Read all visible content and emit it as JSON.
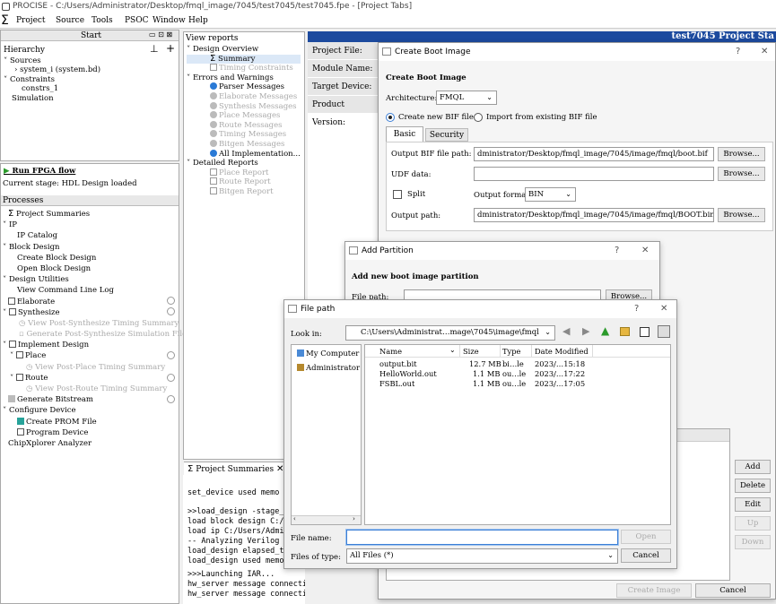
{
  "window": {
    "title": "PROCISE - C:/Users/Administrator/Desktop/fmql_image/7045/test7045/test7045.fpe - [Project Tabs]"
  },
  "menu": [
    "Project",
    "Source",
    "Tools",
    "PSOC",
    "Window",
    "Help"
  ],
  "hierarchy": {
    "start_label": "Start",
    "title": "Hierarchy",
    "items": [
      "Sources",
      "system_i (system.bd)",
      "Constraints",
      "constrs_1",
      "Simulation"
    ]
  },
  "flow": {
    "run_label": "Run FPGA flow",
    "stage": "Current stage: HDL Design loaded",
    "processes_title": "Processes",
    "items": [
      "Project Summaries",
      "IP",
      "IP Catalog",
      "Block Design",
      "Create Block Design",
      "Open Block Design",
      "Design Utilities",
      "View Command Line Log",
      "Elaborate",
      "Synthesize",
      "View Post-Synthesize Timing Summary",
      "Generate Post-Synthesize Simulation File",
      "Implement Design",
      "Place",
      "View Post-Place Timing Summary",
      "Route",
      "View Post-Route Timing Summary",
      "Generate Bitstream",
      "Configure Device",
      "Create PROM File",
      "Program Device",
      "ChipXplorer Analyzer"
    ]
  },
  "reports": {
    "title": "View reports",
    "items": [
      "Design Overview",
      "Summary",
      "Timing Constraints",
      "Errors and Warnings",
      "Parser Messages",
      "Elaborate Messages",
      "Synthesis Messages",
      "Place Messages",
      "Route Messages",
      "Timing Messages",
      "Bitgen Messages",
      "All Implementation...",
      "Detailed Reports",
      "Place Report",
      "Route Report",
      "Bitgen Report"
    ],
    "tab_label": "Project Summaries"
  },
  "project_tab": {
    "header": "test7045 Project Sta",
    "rows": [
      "Project File:",
      "Module Name:",
      "Target Device:",
      "Product Version:"
    ]
  },
  "console": {
    "lines": [
      "set_device used memo",
      ">>load_design -stage_el",
      "  load block design C:/",
      "  load ip C:/Users/Admi",
      "  -- Analyzing Verilog",
      "  load_design elapsed_t",
      "  load_design used memo",
      ">>>Launching IAR...",
      "  hw_server message connection interrupt, err",
      "  hw_server message connection interrupt, err"
    ]
  },
  "boot_dialog": {
    "title": "Create Boot Image",
    "heading": "Create Boot Image",
    "architecture_label": "Architecture:",
    "architecture_value": "FMQL",
    "radio_new": "Create new BIF file",
    "radio_import": "Import from existing BIF file",
    "tabs": [
      "Basic",
      "Security"
    ],
    "output_bif_label": "Output BIF file path:",
    "output_bif_value": "dministrator/Desktop/fmql_image/7045/image/fmql/boot.bif",
    "udf_label": "UDF data:",
    "udf_value": "",
    "split_label": "Split",
    "output_format_label": "Output format",
    "output_format_value": "BIN",
    "output_path_label": "Output path:",
    "output_path_value": "dministrator/Desktop/fmql_image/7045/image/fmql/BOOT.bin",
    "browse": "Browse...",
    "side_buttons": [
      "Add",
      "Delete",
      "Edit",
      "Up",
      "Down"
    ],
    "create_button": "Create Image",
    "cancel_button": "Cancel"
  },
  "partition_dialog": {
    "title": "Add Partition",
    "heading": "Add new boot image partition",
    "file_path_label": "File path:",
    "browse": "Browse..."
  },
  "file_dialog": {
    "title": "File path",
    "look_in_label": "Look in:",
    "look_in_value": "C:\\Users\\Administrat…mage\\7045\\image\\fmql",
    "places": [
      "My Computer",
      "Administrator"
    ],
    "columns": [
      "Name",
      "Size",
      "Type",
      "Date Modified"
    ],
    "files": [
      {
        "name": "output.bit",
        "size": "12.7 MB",
        "type": "bi…le",
        "date": "2023/…15:18"
      },
      {
        "name": "HelloWorld.out",
        "size": "1.1 MB",
        "type": "ou…le",
        "date": "2023/…17:22"
      },
      {
        "name": "FSBL.out",
        "size": "1.1 MB",
        "type": "ou…le",
        "date": "2023/…17:05"
      }
    ],
    "file_name_label": "File name:",
    "file_name_value": "",
    "files_of_type_label": "Files of type:",
    "files_of_type_value": "All Files (*)",
    "open_button": "Open",
    "cancel_button": "Cancel"
  },
  "colors": {
    "accent": "#1c4a9e",
    "selection": "#dbe8f7",
    "focus": "#3c7fd6"
  }
}
